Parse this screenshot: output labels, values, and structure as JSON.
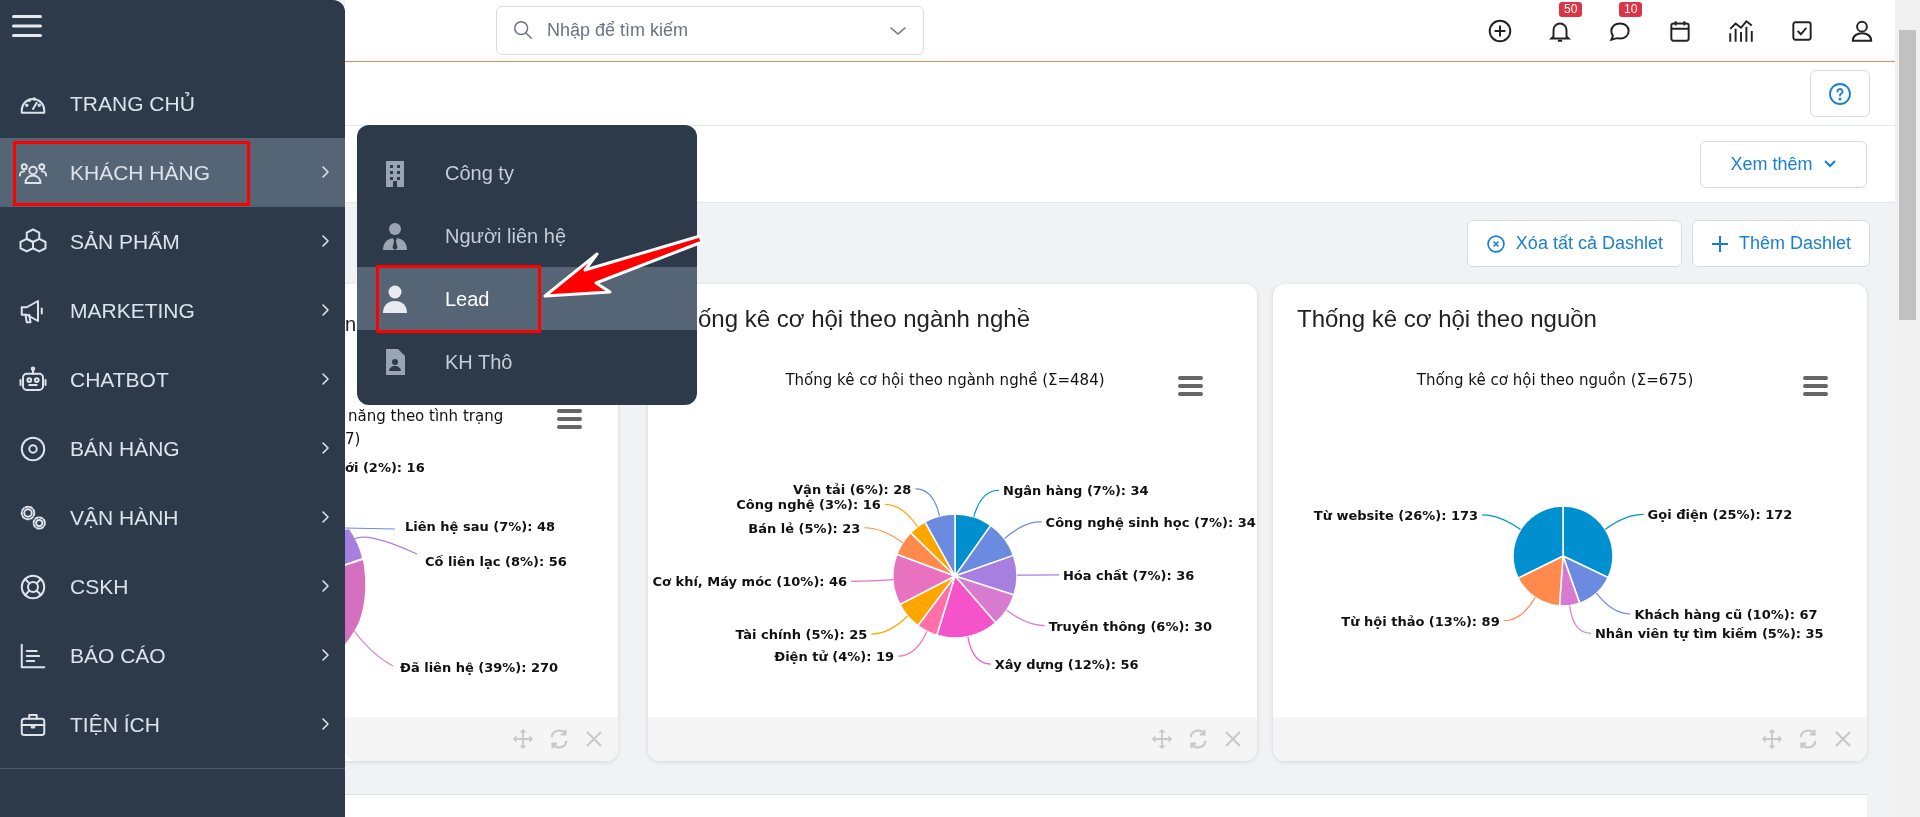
{
  "sidebar": {
    "items": [
      {
        "label": "TRANG CHỦ",
        "selected": false,
        "submenu": false,
        "annotated": false
      },
      {
        "label": "KHÁCH HÀNG",
        "selected": true,
        "submenu": true,
        "annotated": true
      },
      {
        "label": "SẢN PHẨM",
        "selected": false,
        "submenu": true,
        "annotated": false
      },
      {
        "label": "MARKETING",
        "selected": false,
        "submenu": true,
        "annotated": false
      },
      {
        "label": "CHATBOT",
        "selected": false,
        "submenu": true,
        "annotated": false
      },
      {
        "label": "BÁN HÀNG",
        "selected": false,
        "submenu": true,
        "annotated": false
      },
      {
        "label": "VẬN HÀNH",
        "selected": false,
        "submenu": true,
        "annotated": false
      },
      {
        "label": "CSKH",
        "selected": false,
        "submenu": true,
        "annotated": false
      },
      {
        "label": "BÁO CÁO",
        "selected": false,
        "submenu": true,
        "annotated": false
      },
      {
        "label": "TIỆN ÍCH",
        "selected": false,
        "submenu": true,
        "annotated": false
      }
    ]
  },
  "flyout": {
    "items": [
      {
        "label": "Công ty",
        "selected": false,
        "annotated": false
      },
      {
        "label": "Người liên hệ",
        "selected": false,
        "annotated": false
      },
      {
        "label": "Lead",
        "selected": true,
        "annotated": true
      },
      {
        "label": "KH Thô",
        "selected": false,
        "annotated": false
      }
    ]
  },
  "search": {
    "placeholder": "Nhập để tìm kiếm"
  },
  "toolbar": [
    {
      "kind": "add"
    },
    {
      "kind": "notifications",
      "badge": "50"
    },
    {
      "kind": "messages",
      "badge": "10"
    },
    {
      "kind": "calendar"
    },
    {
      "kind": "analytics"
    },
    {
      "kind": "tasks"
    },
    {
      "kind": "account"
    }
  ],
  "actions": {
    "more": "Xem thêm",
    "clear_all": "Xóa tất cả Dashlet",
    "add": "Thêm Dashlet"
  },
  "dashlets": [
    {
      "title": "n",
      "chart_title": [
        "năng theo tình trạng",
        "7)"
      ],
      "labels": [
        "ới (2%): 16",
        "Liên hệ sau (7%): 48",
        "Cố liên lạc (8%): 56",
        "Đã liên hệ (39%): 270"
      ]
    },
    {
      "title": "ống kê cơ hội theo ngành nghề",
      "chart_data": {
        "type": "pie",
        "title": "Thống kê cơ hội theo ngành nghề (Σ=484)",
        "categories": [
          "Ngân hàng (7%): 34",
          "Công nghệ sinh học (7%): 34",
          "Hóa chất (7%): 36",
          "Truyền thông (6%): 30",
          "Xây dựng (12%): 56",
          "Điện tử (4%): 19",
          "Tài chính (5%): 25",
          "Cơ khí, Máy móc (10%): 46",
          "Bán lẻ (5%): 23",
          "Công nghệ (3%): 16",
          "Vận tải (6%): 28"
        ],
        "values": [
          34,
          34,
          36,
          30,
          56,
          19,
          25,
          46,
          23,
          16,
          28
        ]
      }
    },
    {
      "title": "Thống kê cơ hội theo nguồn",
      "chart_data": {
        "type": "pie",
        "title": "Thống kê cơ hội theo nguồn (Σ=675)",
        "categories": [
          "Gọi điện (25%): 172",
          "Khách hàng cũ (10%): 67",
          "Nhân viên tự tìm kiếm (5%): 35",
          "Từ hội thảo (13%): 89",
          "Từ website (26%): 173"
        ],
        "values": [
          172,
          67,
          35,
          89,
          173
        ]
      }
    }
  ]
}
